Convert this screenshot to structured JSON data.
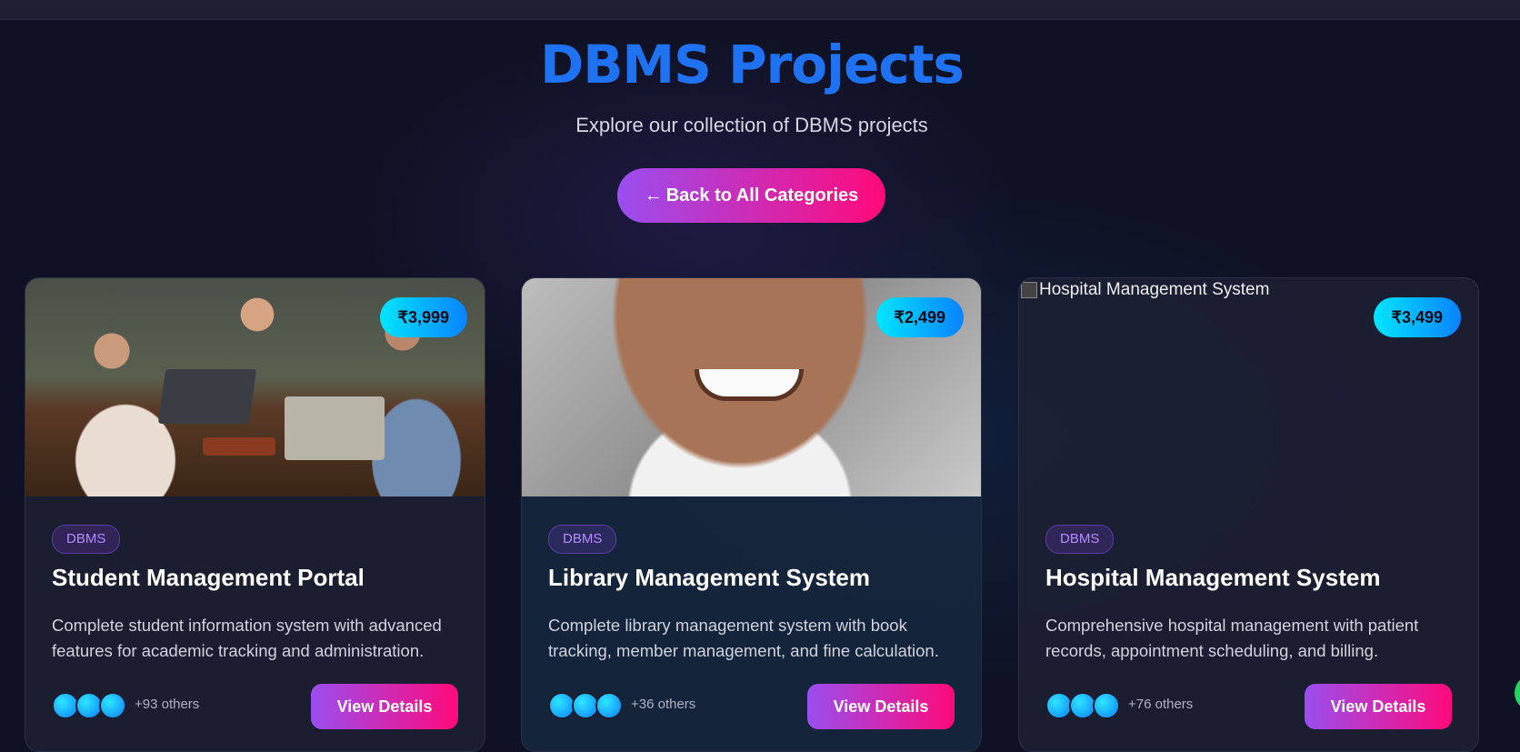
{
  "header": {
    "title": "DBMS Projects",
    "subtitle": "Explore our collection of DBMS projects",
    "back_arrow": "←",
    "back_label": "Back to All Categories"
  },
  "cards": [
    {
      "image_alt": "",
      "price": "₹3,999",
      "tag": "DBMS",
      "title": "Student Management Portal",
      "description": "Complete student information system with advanced features for academic tracking and administration.",
      "others": "+93 others",
      "button": "View Details"
    },
    {
      "image_alt": "",
      "price": "₹2,499",
      "tag": "DBMS",
      "title": "Library Management System",
      "description": "Complete library management system with book tracking, member management, and fine calculation.",
      "others": "+36 others",
      "button": "View Details"
    },
    {
      "image_alt": "Hospital Management System",
      "price": "₹3,499",
      "tag": "DBMS",
      "title": "Hospital Management System",
      "description": "Comprehensive hospital management with patient records, appointment scheduling, and billing.",
      "others": "+76 others",
      "button": "View Details"
    }
  ],
  "colors": {
    "title": "#1f73f2",
    "accent_gradient_start": "#9a4ef0",
    "accent_gradient_end": "#ff0a7a",
    "price_gradient_start": "#00e5ff",
    "price_gradient_end": "#0a82ff",
    "background": "#0f1224"
  },
  "icons": [
    "back-arrow-icon",
    "whatsapp-fab-icon",
    "broken-image-icon"
  ]
}
